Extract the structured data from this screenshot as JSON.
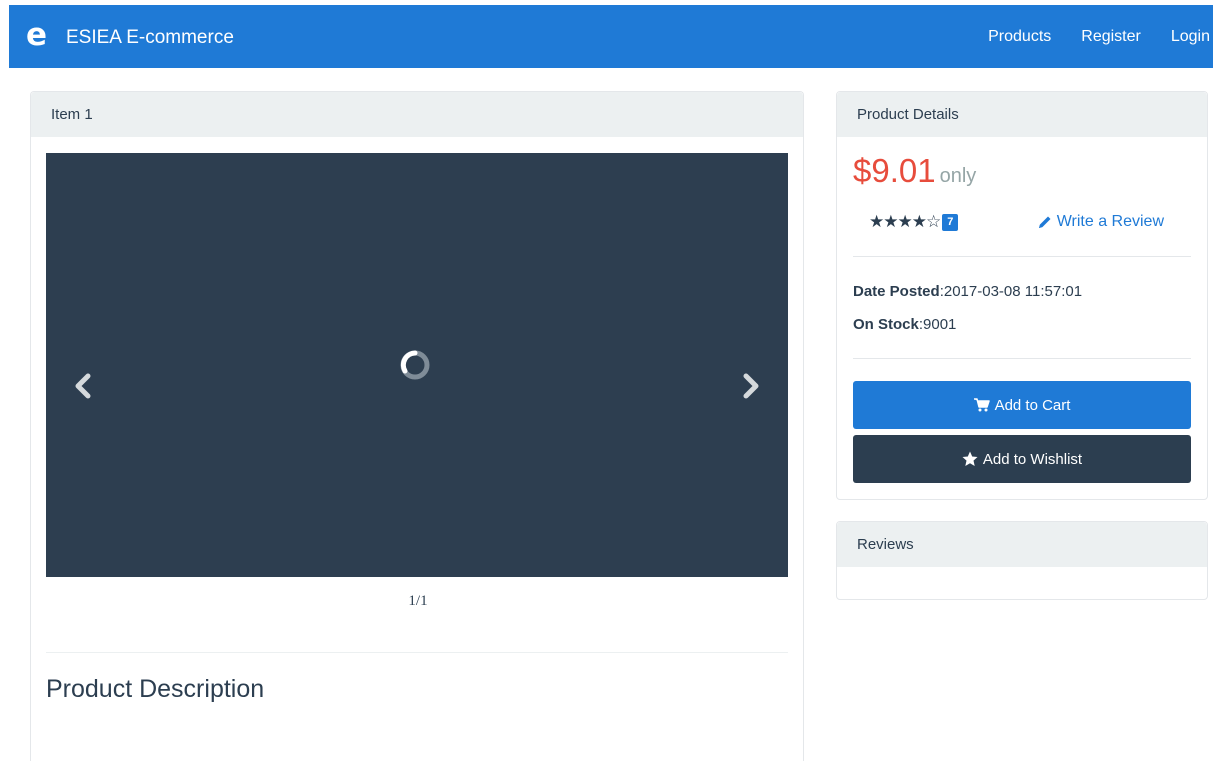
{
  "navbar": {
    "logo_letter": "e",
    "brand": "ESIEA E-commerce",
    "links": [
      "Products",
      "Register",
      "Login"
    ]
  },
  "item_panel": {
    "title": "Item 1",
    "slide_counter": "1/1",
    "description_title": "Product Description"
  },
  "details_panel": {
    "title": "Product Details",
    "price": "$9.01",
    "price_suffix": "only",
    "rating_stars": "★★★★☆",
    "review_count": "7",
    "write_review": "Write a Review",
    "date_label": "Date Posted",
    "date_value": ":2017-03-08 11:57:01",
    "stock_label": "On Stock",
    "stock_value": ":9001",
    "add_to_cart": "Add to Cart",
    "add_to_wishlist": "Add to Wishlist"
  },
  "reviews_panel": {
    "title": "Reviews"
  },
  "icons": {
    "carousel_prev": "chevron-left-icon",
    "carousel_next": "chevron-right-icon",
    "loading": "spinner-icon",
    "review": "pencil-icon",
    "cart": "cart-icon",
    "wishlist": "star-icon"
  },
  "colors": {
    "primary": "#1f7ad6",
    "dark": "#2c3e50",
    "price": "#e74c3c",
    "muted": "#95a5a6",
    "panel_heading": "#ecf0f1"
  }
}
